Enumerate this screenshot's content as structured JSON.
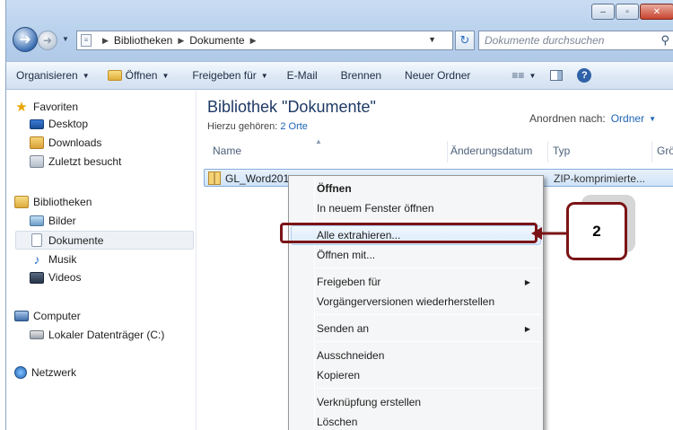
{
  "address": {
    "crumbs": [
      "Bibliotheken",
      "Dokumente"
    ],
    "search_placeholder": "Dokumente durchsuchen"
  },
  "window_buttons": [
    "–",
    "▫",
    "✕"
  ],
  "toolbar": {
    "organize": "Organisieren",
    "open": "Öffnen",
    "share": "Freigeben für",
    "email": "E-Mail",
    "burn": "Brennen",
    "new_folder": "Neuer Ordner"
  },
  "nav": {
    "favorites": "Favoriten",
    "desktop": "Desktop",
    "downloads": "Downloads",
    "recent": "Zuletzt besucht",
    "libraries": "Bibliotheken",
    "pictures": "Bilder",
    "documents": "Dokumente",
    "music": "Musik",
    "videos": "Videos",
    "computer": "Computer",
    "local_disk": "Lokaler Datenträger (C:)",
    "network": "Netzwerk"
  },
  "library": {
    "title": "Bibliothek \"Dokumente\"",
    "includes_label": "Hierzu gehören:",
    "includes_link": "2 Orte",
    "arrange_label": "Anordnen nach:",
    "arrange_value": "Ordner"
  },
  "columns": {
    "name": "Name",
    "date": "Änderungsdatum",
    "type": "Typ",
    "size": "Grö"
  },
  "file": {
    "name": "GL_Word201",
    "type": "ZIP-komprimierte..."
  },
  "context_menu": {
    "open": "Öffnen",
    "open_new_window": "In neuem Fenster öffnen",
    "extract_all": "Alle extrahieren...",
    "open_with": "Öffnen mit...",
    "share": "Freigeben für",
    "previous_versions": "Vorgängerversionen wiederherstellen",
    "send_to": "Senden an",
    "cut": "Ausschneiden",
    "copy": "Kopieren",
    "create_shortcut": "Verknüpfung erstellen",
    "delete": "Löschen"
  },
  "annotation": {
    "step": "2",
    "color": "#7b1416"
  }
}
